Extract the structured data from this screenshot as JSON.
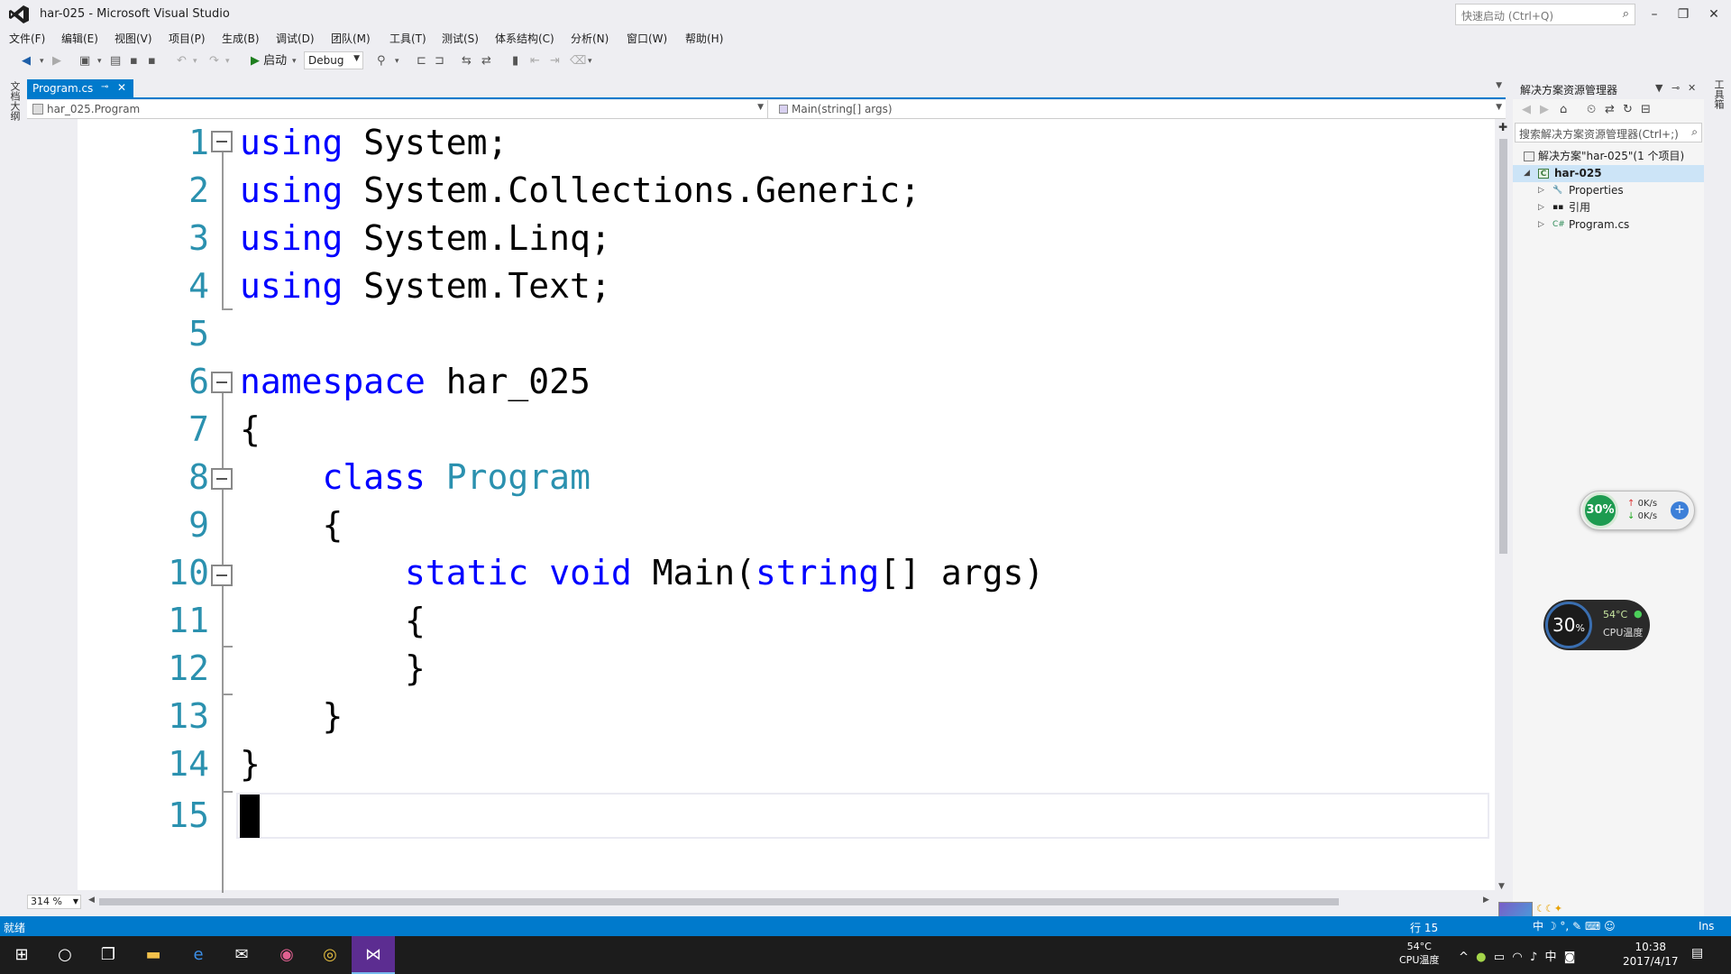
{
  "window": {
    "title": "har-025 - Microsoft Visual Studio",
    "quick_launch_placeholder": "快速启动 (Ctrl+Q)"
  },
  "menu": [
    "文件(F)",
    "编辑(E)",
    "视图(V)",
    "项目(P)",
    "生成(B)",
    "调试(D)",
    "团队(M)",
    "工具(T)",
    "测试(S)",
    "体系结构(C)",
    "分析(N)",
    "窗口(W)",
    "帮助(H)"
  ],
  "toolbar": {
    "start_label": "启动",
    "config": "Debug"
  },
  "left_strip_label": "文档大纲",
  "right_strip_label": "工具箱",
  "tab": {
    "label": "Program.cs"
  },
  "navbar": {
    "class_path": "har_025.Program",
    "member": "Main(string[] args)"
  },
  "code_lines": [
    {
      "num": "1"
    },
    {
      "num": "2"
    },
    {
      "num": "3"
    },
    {
      "num": "4"
    },
    {
      "num": "5"
    },
    {
      "num": "6"
    },
    {
      "num": "7"
    },
    {
      "num": "8"
    },
    {
      "num": "9"
    },
    {
      "num": "10"
    },
    {
      "num": "11"
    },
    {
      "num": "12"
    },
    {
      "num": "13"
    },
    {
      "num": "14"
    },
    {
      "num": "15"
    }
  ],
  "code": {
    "using": "using",
    "l1": " System;",
    "l2": " System.Collections.Generic;",
    "l3": " System.Linq;",
    "l4": " System.Text;",
    "namespace_kw": "namespace",
    "namespace_name": " har_025",
    "open_brace": "{",
    "close_brace": "}",
    "class_kw": "class",
    "class_name": "Program",
    "static_kw": "static",
    "void_kw": "void",
    "main_name": "Main(",
    "string_kw": "string",
    "main_args": "[] args)"
  },
  "zoom": "314 %",
  "solution_explorer": {
    "title": "解决方案资源管理器",
    "search_placeholder": "搜索解决方案资源管理器(Ctrl+;)",
    "solution": "解决方案\"har-025\"(1 个项目)",
    "project": "har-025",
    "items": [
      "Properties",
      "引用",
      "Program.cs"
    ]
  },
  "net_widget": {
    "percent": "30%",
    "up": "0K/s",
    "down": "0K/s"
  },
  "cpu_widget": {
    "percent": "30",
    "percent_sign": "%",
    "temp": "54°C",
    "label": "CPU温度"
  },
  "status": {
    "ready": "就绪",
    "line": "行 15",
    "ins": "Ins",
    "ime": "中"
  },
  "taskbar": {
    "cpu_temp": "54°C",
    "cpu_label": "CPU温度",
    "tray_ime": "中",
    "time": "10:38",
    "date": "2017/4/17"
  },
  "colors": {
    "accent": "#007acc",
    "keyword": "#0000ff",
    "type": "#2b91af",
    "line_number": "#2b91af"
  }
}
